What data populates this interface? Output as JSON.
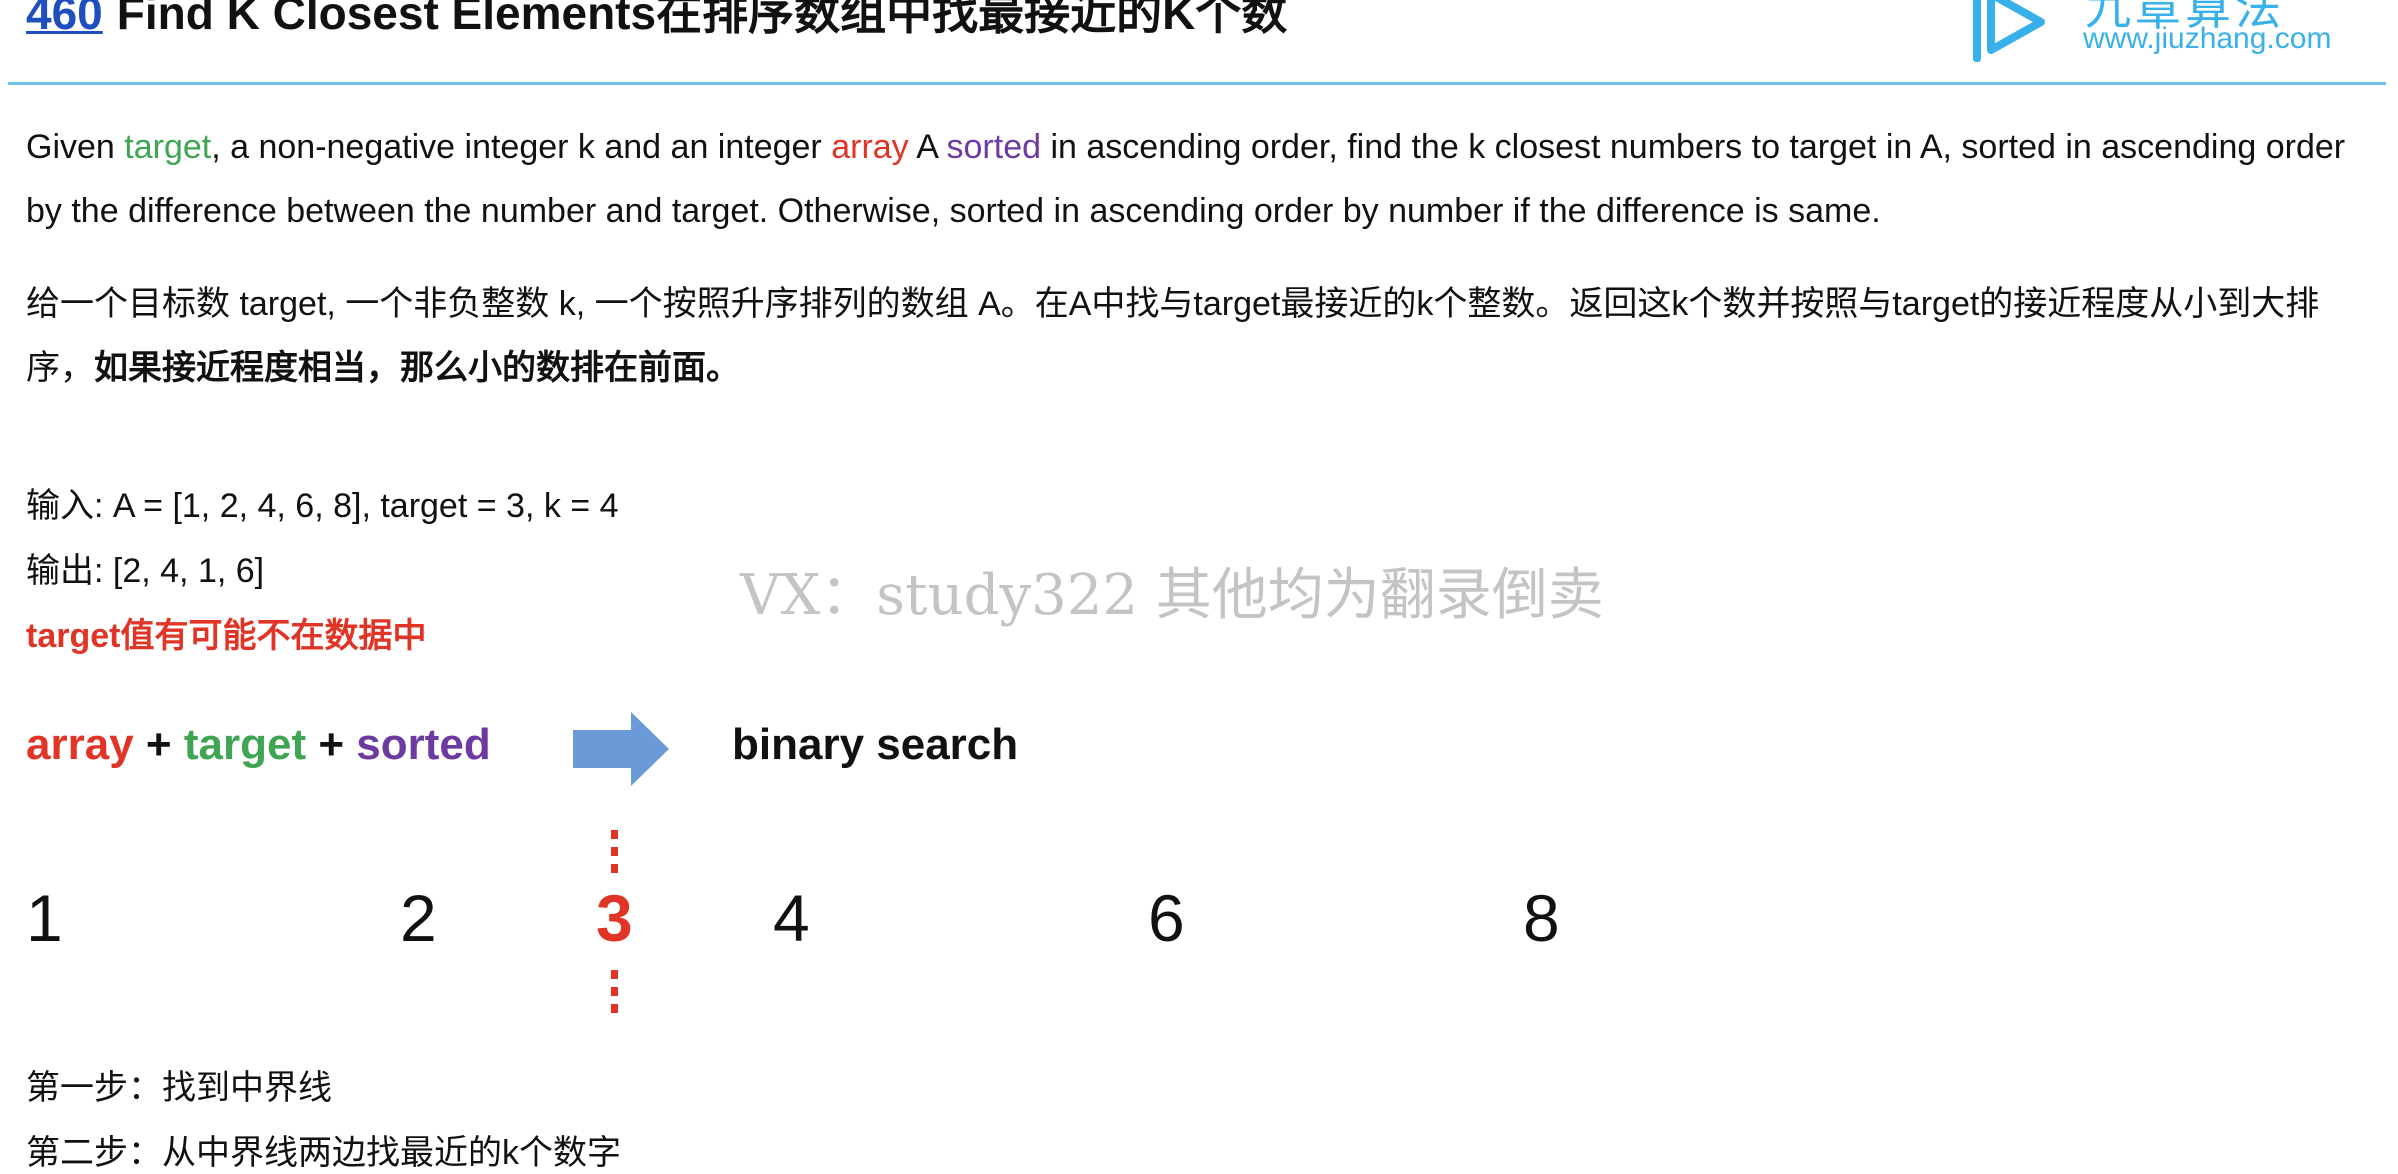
{
  "header": {
    "problem_number": "460",
    "title": "Find K Closest Elements在排序数组中找最接近的K个数",
    "logo_cn": "九章算法",
    "logo_url": "www.jiuzhang.com"
  },
  "description_en": {
    "s1": "Given ",
    "w_target": "target",
    "s2": ", a non-negative integer k and an integer ",
    "w_array": "array",
    "s3": " A ",
    "w_sorted": "sorted",
    "s4": " in ascending order, find the k closest numbers to target in A, sorted in ascending order by the difference between the number and target. Otherwise, sorted in ascending order by number if the difference is same."
  },
  "description_cn": {
    "normal": "给一个目标数 target, 一个非负整数 k, 一个按照升序排列的数组 A。在A中找与target最接近的k个整数。返回这k个数并按照与target的接近程度从小到大排序，",
    "bold": "如果接近程度相当，那么小的数排在前面。"
  },
  "example": {
    "input": "输入: A = [1, 2, 4, 6, 8], target = 3, k = 4",
    "output": "输出: [2, 4, 1, 6]",
    "note": "target值有可能不在数据中"
  },
  "watermark": "VX：study322 其他均为翻录倒卖",
  "formula": {
    "array": "array",
    "plus": "+",
    "target": "target",
    "sorted": "sorted",
    "result": "binary search"
  },
  "number_line": {
    "values": [
      "1",
      "2",
      "4",
      "6",
      "8"
    ],
    "target": "3"
  },
  "steps": [
    "第一步：找到中界线",
    "第二步：从中界线两边找最近的k个数字"
  ],
  "colors": {
    "green": "#3fa552",
    "red": "#e03526",
    "purple": "#6c3aa0",
    "accent_blue": "#38b1ea",
    "arrow_blue": "#6a9bd8"
  }
}
